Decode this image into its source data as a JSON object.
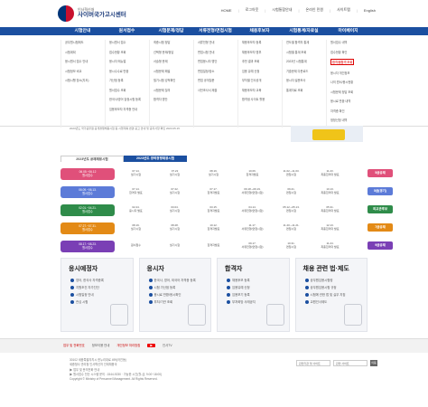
{
  "header": {
    "logo_small": "인사혁신처",
    "logo_big": "사이버국가고시센터",
    "util": [
      "HOME",
      "로그아웃",
      "시험통합안내",
      "온라인 민원",
      "사이트맵",
      "English"
    ]
  },
  "gnb": [
    "시험안내",
    "원서접수",
    "시험문제/정답",
    "서류전형/면접시험",
    "채용후보자",
    "시험통계/자료실",
    "마이페이지"
  ],
  "dropdown": [
    [
      "공무원시험제도",
      "시험계획",
      "응시원서 접수 안내",
      "시험정보 비교",
      "시험시행 장소(지도)"
    ],
    [
      "응시원서 접수",
      "접수현황 조회",
      "응시자 매뉴얼",
      "응시수수료 반환",
      "가산점 등록",
      "원서접수 조회",
      "한국사/영어 검정시험 등록",
      "임용후보자 자격증 안내"
    ],
    [
      "최종시험 정답",
      "선택형 문제/정답",
      "서술형 문제",
      "시험문제 해설",
      "필기시험 성적확인",
      "시험문제 질의",
      "합격자 명단"
    ],
    [
      "서류전형 안내",
      "면접시험 안내",
      "면접응시자 명단",
      "면접일정/장소",
      "면접 공개질문",
      "사전조사서 제출"
    ],
    [
      "채용후보자 등록",
      "채용후보자 명부",
      "추천 결과 조회",
      "임용 유예 신청",
      "부처별 인사공개",
      "채용후보자 교육",
      "합격생 사이트 활용"
    ],
    [
      "연도별 합격자 통계",
      "시험별 통계 조회",
      "2023년 시험통계",
      "기출문제 다운로드",
      "응시자 설문조사",
      "통계자료 조회"
    ],
    [
      "원서접수 내역",
      "접수현황 확인",
      "합격/불합격 조회",
      "응시자 개인정보",
      "나의 원서/응시현황",
      "시험문제 정답 조회",
      "응시료 반환 내역",
      "자격증 확인",
      "정정신청 내역"
    ]
  ],
  "dropdown_highlight": "합격/불합격 조회",
  "notice": "2023년도 국가공무원 공개경쟁채용시험 등 시행계획 변경 공고 안내 및 공지사항 확인",
  "notice_date": "2023.05.15",
  "schedule": {
    "tabs": [
      "2023년도 공채채용시험",
      "2023년도 경력경쟁채용시험"
    ],
    "rows": [
      {
        "label": "06.05.~06.12",
        "sub": "원서접수",
        "color": "#e0507a",
        "cells": [
          [
            "07.14.",
            "필기시험"
          ],
          [
            "07.22",
            "필기시험"
          ],
          [
            "08.19.",
            "필기시험"
          ],
          [
            "10.06.",
            "합격자발표"
          ],
          [
            "11.02.~11.03.",
            "면접시험"
          ],
          [
            "11.23.",
            "최종합격자 발표"
          ]
        ],
        "tag": "5급공채",
        "tagColor": "#e0507a"
      },
      {
        "label": "06.09.~06.13.",
        "sub": "원서접수",
        "color": "#5c7bd8",
        "cells": [
          [
            "07.14.",
            "합격자 발표"
          ],
          [
            "07.22.",
            "필기시험"
          ],
          [
            "07.17.",
            "합격자발표"
          ],
          [
            "09.18.~09.19.",
            "서류전형(면접시험)"
          ],
          [
            "09.21.",
            "면접시험"
          ],
          [
            "10.13.",
            "최종합격자 발표"
          ]
        ],
        "tag": "5급(경기)",
        "tagColor": "#5c7bd8"
      },
      {
        "label": "02.01.~04.21.",
        "sub": "원서접수",
        "color": "#2f8c4a",
        "cells": [
          [
            "02.24.",
            "응시자 발표"
          ],
          [
            "03.04.",
            "필기시험"
          ],
          [
            "03.15.",
            "합격자발표"
          ],
          [
            "04.14.",
            "서류전형(면접시험)"
          ],
          [
            "05.12.~05.13.",
            "면접시험"
          ],
          [
            "05.31.",
            "최종합격자 발표"
          ]
        ],
        "tag": "외교관후보",
        "tagColor": "#2f8c4a"
      },
      {
        "label": "07.27.~07.31.",
        "sub": "원서접수",
        "color": "#e38a16",
        "cells": [
          [
            "08.19.",
            "필기시험"
          ],
          [
            "08.28.",
            "필기시험"
          ],
          [
            "10.12.",
            "합격자발표"
          ],
          [
            "11.17.",
            "서류전형(면접시험)"
          ],
          [
            "11.20.~11.21.",
            "면접시험"
          ],
          [
            "12.13.",
            "최종합격자 발표"
          ]
        ],
        "tag": "7급공채",
        "tagColor": "#e38a16"
      },
      {
        "label": "08.17.~08.23.",
        "sub": "원서접수",
        "color": "#7a3fb5",
        "cells": [
          [
            "",
            "원서접수"
          ],
          [
            "",
            "필기시험"
          ],
          [
            "",
            "합격자발표"
          ],
          [
            "09.17.",
            "서류전형(면접시험)"
          ],
          [
            "10.31.",
            "면접시험"
          ],
          [
            "11.24.",
            "최종합격자 발표"
          ]
        ],
        "tag": "9급공채",
        "tagColor": "#7a3fb5"
      }
    ]
  },
  "quick": [
    {
      "title": "응시예정자",
      "links": [
        "영어, 한국사 자격증록",
        "지원조건 자가진단",
        "시험일정 안내",
        "관심 시험"
      ]
    },
    {
      "title": "응시자",
      "links": [
        "한국사, 영어, 외국어 자격증 등록",
        "시험 가산점 등록",
        "응시료 반환/응시확인",
        "부처/기관 조회"
      ]
    },
    {
      "title": "합격자",
      "links": [
        "채용후보 등록",
        "임용유예 신청",
        "임용포기 등록",
        "부처희망 사레공지"
      ]
    },
    {
      "title": "채용 관련 법·제도",
      "links": [
        "공무원임용시험령",
        "공무원임용시험 규정",
        "시험에 관한 법 및 실무 지침",
        "교원인사제도"
      ]
    }
  ],
  "footnav": [
    "업무 및 전화번호",
    "정보이용 안내",
    "개인정보 처리방침",
    "인사TV"
  ],
  "footer": {
    "lines": [
      "30102 세종특별자치시 한누리대로 499(어진동)",
      "세종청사 관리청 인사혁신처 인재채용국",
      "▶ 업무 및 문의전화 안내",
      "▶ 원서접수 전산 시스템 문의 : 1544-9230 · 가능한 시간(월-금, 9:00~18:00)",
      "Copyright © Ministry of Personnel Management. All Rights Reserved."
    ],
    "select1": "관련기관 및 사이트",
    "select2": "관련 사이트",
    "go": "이동"
  }
}
